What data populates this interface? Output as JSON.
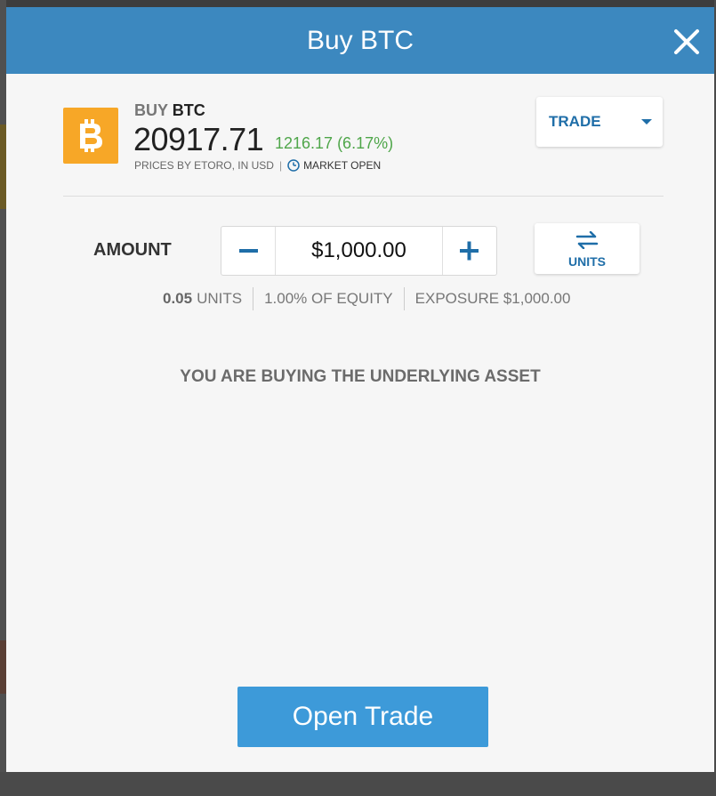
{
  "modal": {
    "title": "Buy BTC"
  },
  "instrument": {
    "action": "BUY",
    "symbol": "BTC",
    "price": "20917.71",
    "change": "1216.17 (6.17%)",
    "prices_note": "PRICES BY ETORO, IN USD",
    "separator": "|",
    "market_status": "MARKET OPEN",
    "logo_icon": "bitcoin-icon",
    "logo_color": "#f7a727"
  },
  "order_type": {
    "selected": "TRADE"
  },
  "amount": {
    "label": "AMOUNT",
    "value": "$1,000.00",
    "units_toggle_label": "UNITS",
    "units_count": "0.05",
    "units_suffix": "UNITS",
    "equity": "1.00% OF EQUITY",
    "exposure": "EXPOSURE $1,000.00"
  },
  "notice": "YOU ARE BUYING THE UNDERLYING ASSET",
  "actions": {
    "open_trade": "Open Trade"
  },
  "colors": {
    "header": "#3c88bf",
    "accent": "#1f6ea8",
    "positive": "#4fa64a",
    "primary_button": "#3d9ad9"
  }
}
